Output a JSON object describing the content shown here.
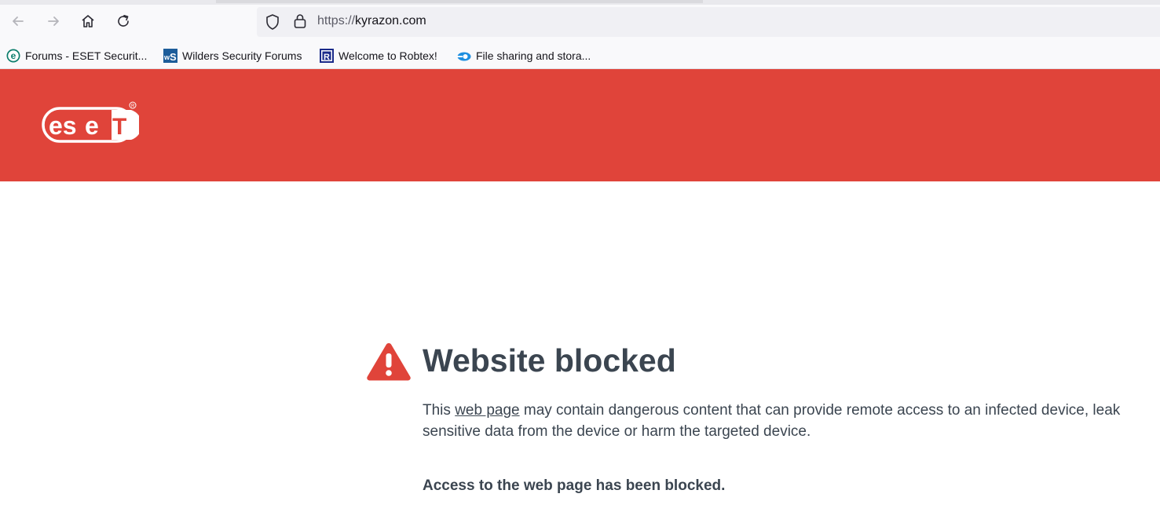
{
  "browser": {
    "url_scheme": "https://",
    "url_host": "kyrazon.com",
    "bookmarks": [
      {
        "label": "Forums - ESET Securit...",
        "icon": "eset-favicon"
      },
      {
        "label": "Wilders Security Forums",
        "icon": "wilders-favicon"
      },
      {
        "label": "Welcome to Robtex!",
        "icon": "robtex-favicon"
      },
      {
        "label": "File sharing and stora...",
        "icon": "file-sharing-favicon"
      }
    ]
  },
  "brand": {
    "logo_text": "eset",
    "banner_color": "#e0443a"
  },
  "page": {
    "heading": "Website blocked",
    "desc_before": "This ",
    "desc_link": "web page",
    "desc_after": " may contain dangerous content that can provide remote access to an infected device, leak sensitive data from the device or harm the targeted device.",
    "blocked_message": "Access to the web page has been blocked."
  }
}
